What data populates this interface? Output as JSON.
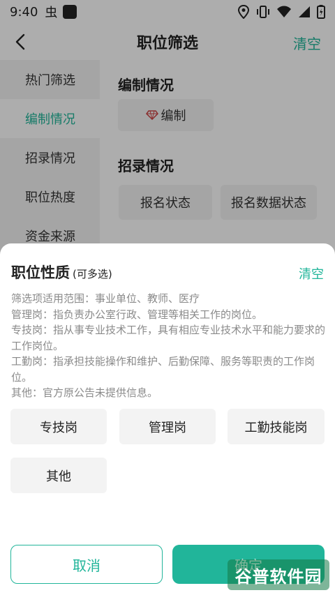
{
  "status_bar": {
    "time": "9:40",
    "app_icon": "虫"
  },
  "top_bar": {
    "title": "职位筛选",
    "clear_label": "清空"
  },
  "left_nav": {
    "items": [
      {
        "label": "热门筛选"
      },
      {
        "label": "编制情况"
      },
      {
        "label": "招录情况"
      },
      {
        "label": "职位热度"
      },
      {
        "label": "资金来源"
      }
    ],
    "active_index": 1
  },
  "content": {
    "section_bianzhi": {
      "title": "编制情况",
      "chip": "编制"
    },
    "section_zhaolu": {
      "title": "招录情况",
      "chips": [
        "报名状态",
        "报名数据状态"
      ]
    }
  },
  "sheet": {
    "title": "职位性质",
    "subtitle": "(可多选)",
    "clear_label": "清空",
    "description": [
      "筛选项适用范围：事业单位、教师、医疗",
      "管理岗：指负责办公室行政、管理等相关工作的岗位。",
      "专技岗：指从事专业技术工作，具有相应专业技术水平和能力要求的工作岗位。",
      "工勤岗：指承担技能操作和维护、后勤保障、服务等职责的工作岗位。",
      "其他：官方原公告未提供信息。"
    ],
    "options": [
      "专技岗",
      "管理岗",
      "工勤技能岗",
      "其他"
    ],
    "cancel_label": "取消",
    "confirm_label": "确定"
  },
  "watermark": {
    "text": "谷普软件园"
  },
  "colors": {
    "accent": "#21b59a",
    "chip_bg": "#f3f3f3",
    "desc_text": "#8a8a8a"
  }
}
